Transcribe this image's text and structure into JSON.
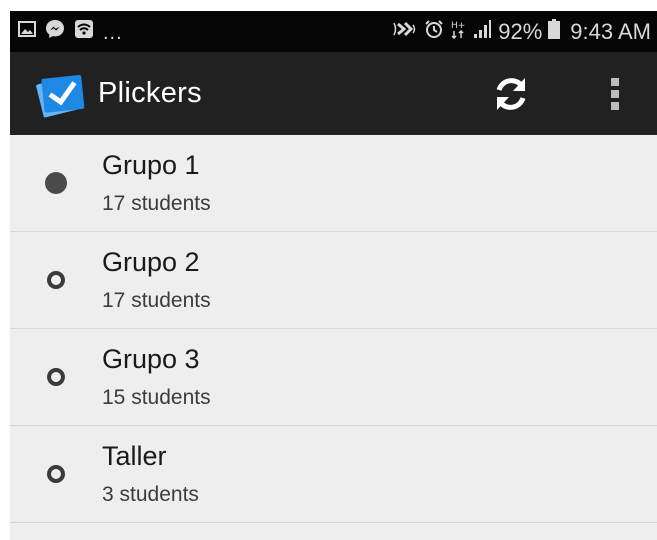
{
  "status_bar": {
    "overflow_dots": "...",
    "battery": "92%",
    "time": "9:43 AM"
  },
  "app_bar": {
    "title": "Plickers",
    "logo_icon": "plickers-check-card-icon",
    "sync_icon": "sync-icon",
    "menu_icon": "overflow-menu-icon"
  },
  "classes": [
    {
      "name": "Grupo 1",
      "students": "17 students",
      "selected": true
    },
    {
      "name": "Grupo 2",
      "students": "17 students",
      "selected": false
    },
    {
      "name": "Grupo 3",
      "students": "15 students",
      "selected": false
    },
    {
      "name": "Taller",
      "students": "3 students",
      "selected": false
    }
  ],
  "colors": {
    "status_bar_bg": "#050505",
    "app_bar_bg": "#212121",
    "list_bg": "#eeeeee",
    "logo_blue": "#2196f3"
  }
}
